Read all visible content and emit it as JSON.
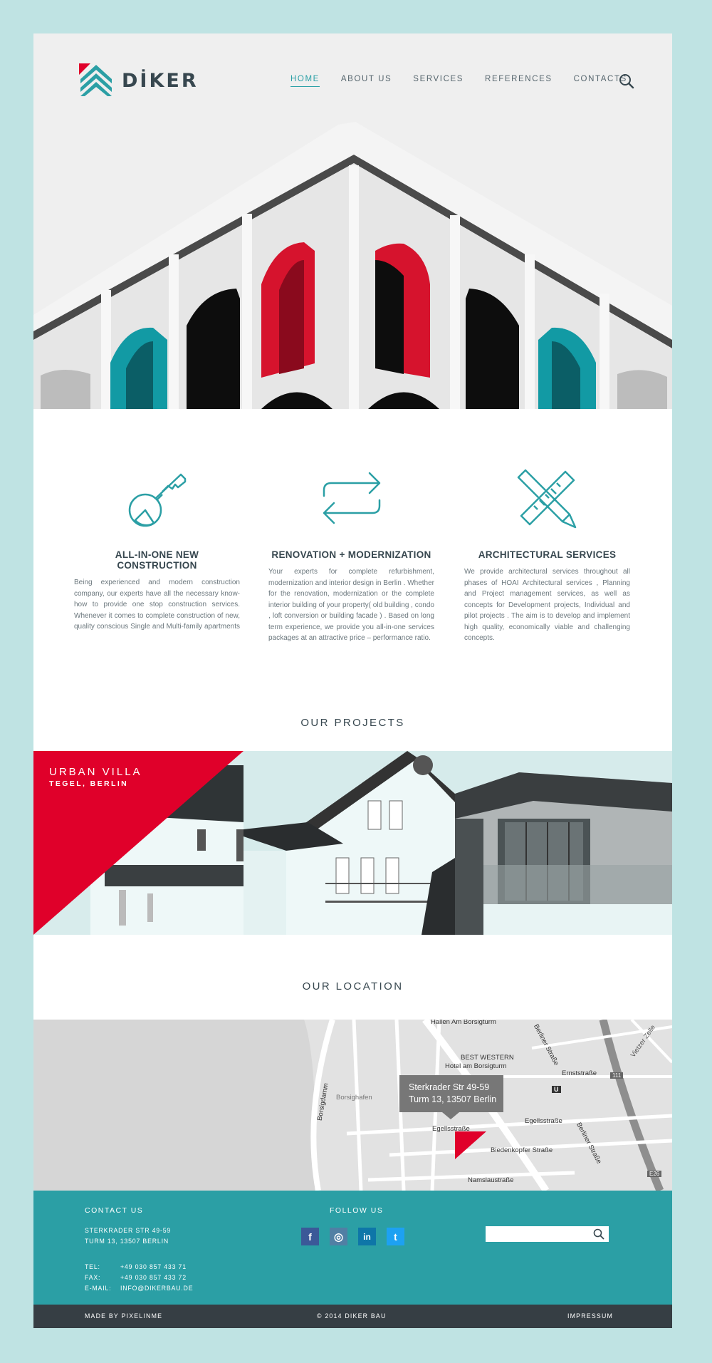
{
  "brand": {
    "name": "DİKER"
  },
  "nav": {
    "items": [
      "HOME",
      "ABOUT US",
      "SERVICES",
      "REFERENCES",
      "CONTACTS"
    ],
    "active": "HOME"
  },
  "services": [
    {
      "title": "ALL-IN-ONE NEW CONSTRUCTION",
      "icon": "key-icon",
      "text": "Being experienced and modern construction company, our experts have all the necessary know-how to provide one stop construction services. Whenever it comes to complete construction of new, quality conscious Single and Multi-family apartments at a competitive price. Of course"
    },
    {
      "title": "RENOVATION + MODERNIZATION",
      "icon": "swap-arrows-icon",
      "text": "Your experts for complete refurbishment, modernization and interior design in Berlin . Whether for the renovation, modernization or the complete interior building of your property( old building , condo , loft conversion or building facade ) . Based on long term experience, we provide you all-in-one services packages at an attractive price – performance ratio."
    },
    {
      "title": "ARCHITECTURAL SERVICES",
      "icon": "ruler-pencil-icon",
      "text": "We provide architectural services throughout all phases of HOAI Architectural services , Planning and Project management services, as well as concepts for Development projects, Individual and pilot projects . The aim is to develop and implement high quality, economically viable and challenging concepts."
    }
  ],
  "projects": {
    "title": "OUR PROJECTS",
    "featured": {
      "name": "URBAN VILLA",
      "location": "TEGEL, BERLIN"
    }
  },
  "location": {
    "title": "OUR LOCATION",
    "tooltip_line1": "Sterkrader Str 49-59",
    "tooltip_line2": "Turm 13, 13507 Berlin",
    "map_labels": {
      "hallen": "Hallen Am Borsigturm",
      "hotel1": "BEST WESTERN",
      "hotel2": "Hotel am Borsigturm",
      "berliner1": "Berliner Straße",
      "berliner2": "Berliner Straße",
      "ernst": "Ernststraße",
      "egell1": "Egellsstraße",
      "egell2": "Egellsstraße",
      "bieden": "Biedenkopfer Straße",
      "namslau": "Namslaustraße",
      "borsigdamm": "Borsigdamm",
      "borsighafen": "Borsighafen",
      "vietzer": "Vietzer Zelle",
      "b111": "111",
      "e26": "E26",
      "ubahn": "U"
    }
  },
  "footer": {
    "contact_title": "CONTACT US",
    "address1": "STERKRADER STR 49-59",
    "address2": "TURM 13, 13507 BERLIN",
    "tel_label": "TEL:",
    "tel": "+49 030 857 433 71",
    "fax_label": "FAX:",
    "fax": "+49 030 857 433 72",
    "email_label": "E-MAIL:",
    "email": "INFO@DIKERBAU.DE",
    "follow_title": "FOLLOW US",
    "social": {
      "facebook": "f",
      "instagram": "◎",
      "linkedin": "in",
      "twitter": "t"
    },
    "search_placeholder": ""
  },
  "bottom_bar": {
    "made_by": "MADE BY PIXELINME",
    "copyright": "© 2014   DIKER BAU",
    "impressum": "IMPRESSUM"
  },
  "colors": {
    "teal": "#2b9fa5",
    "red": "#e0002a",
    "dark": "#363e44",
    "background": "#bfe3e3"
  }
}
